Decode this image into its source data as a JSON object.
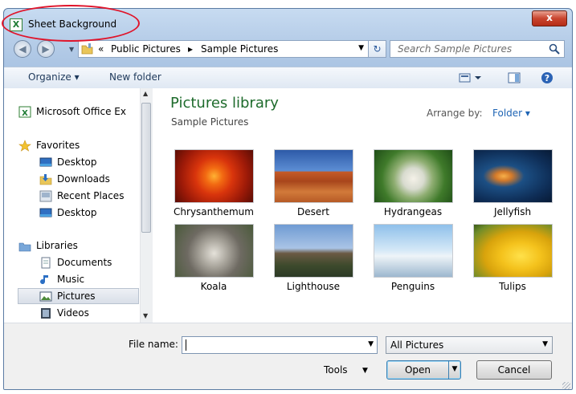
{
  "window": {
    "title": "Sheet Background",
    "app_icon_glyph": "X",
    "close_glyph": "x"
  },
  "nav": {
    "back_glyph": "◀",
    "forward_glyph": "▶",
    "breadcrumbs": [
      "«",
      "Public Pictures",
      "▸",
      "Sample Pictures"
    ],
    "refresh_glyph": "↻",
    "search_placeholder": "Search Sample Pictures"
  },
  "toolbar": {
    "organize_label": "Organize ▾",
    "new_folder_label": "New folder"
  },
  "sidebar": {
    "items": [
      {
        "label": "Microsoft Office Ex",
        "icon": "excel-icon"
      },
      {
        "label": "Favorites",
        "icon": "star-icon"
      },
      {
        "label": "Desktop",
        "icon": "desktop-icon"
      },
      {
        "label": "Downloads",
        "icon": "downloads-icon"
      },
      {
        "label": "Recent Places",
        "icon": "recent-places-icon"
      },
      {
        "label": "Desktop",
        "icon": "desktop-icon"
      },
      {
        "label": "Libraries",
        "icon": "libraries-icon"
      },
      {
        "label": "Documents",
        "icon": "documents-icon"
      },
      {
        "label": "Music",
        "icon": "music-icon"
      },
      {
        "label": "Pictures",
        "icon": "pictures-icon",
        "selected": true
      },
      {
        "label": "Videos",
        "icon": "videos-icon"
      }
    ]
  },
  "library": {
    "title": "Pictures library",
    "subtitle": "Sample Pictures",
    "arrange_label": "Arrange by:",
    "arrange_value": "Folder ▾",
    "items": [
      "Chrysanthemum",
      "Desert",
      "Hydrangeas",
      "Jellyfish",
      "Koala",
      "Lighthouse",
      "Penguins",
      "Tulips"
    ]
  },
  "footer": {
    "file_name_label": "File name:",
    "file_name_value": "",
    "file_type": "All Pictures",
    "tools_label": "Tools",
    "open_label": "Open",
    "cancel_label": "Cancel"
  },
  "colors": {
    "library_title": "#1e6b2c",
    "link_blue": "#1e64b4",
    "annotation_red": "#e0142a"
  }
}
